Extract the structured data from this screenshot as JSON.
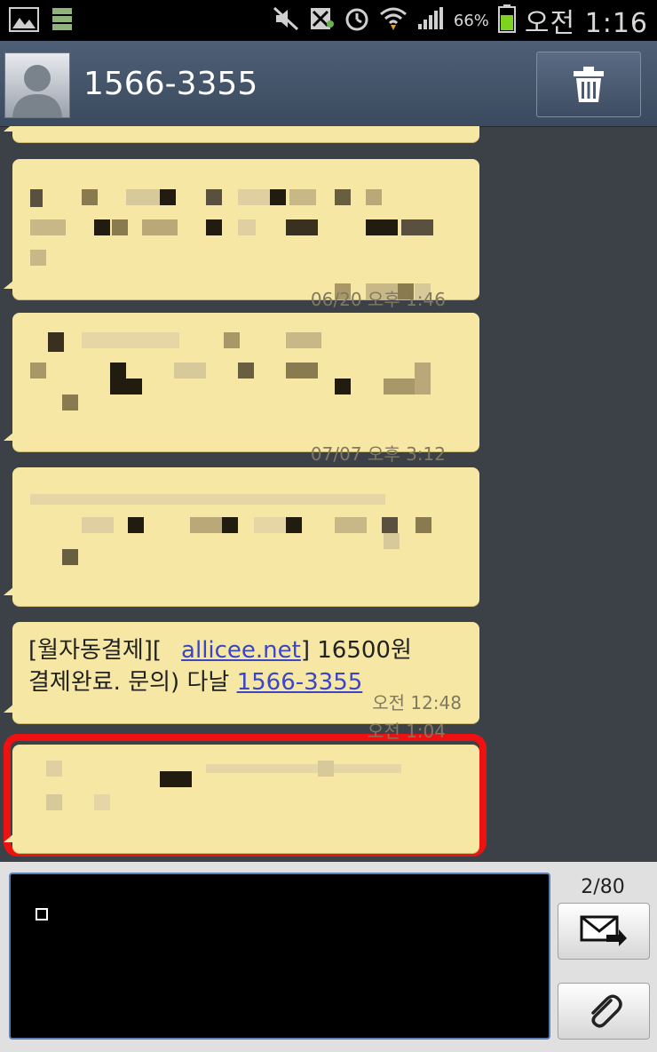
{
  "status_bar": {
    "battery_percent": "66%",
    "time": "오전 1:16",
    "icons": [
      "gallery-icon",
      "storage-icon",
      "mute-icon",
      "no-sim-icon",
      "alarm-icon",
      "wifi-icon",
      "signal-icon",
      "battery-icon"
    ]
  },
  "header": {
    "contact_name": "1566-3355",
    "delete_icon": "trash-icon"
  },
  "messages": [
    {
      "time": "",
      "redacted": true
    },
    {
      "time": "",
      "redacted": true
    },
    {
      "time": "06/20 오후 1:46",
      "redacted": true
    },
    {
      "time": "07/07 오후 3:12",
      "redacted": true
    },
    {
      "redacted": false,
      "highlighted": true,
      "line1_prefix": "[월자동결제][",
      "line1_link": "allicee.net",
      "line1_suffix": "]  16500원",
      "line2_prefix": "결제완료. 문의) 다날 ",
      "line2_link": "1566-3355",
      "time": "오전 12:48"
    },
    {
      "time": "오전 1:04",
      "redacted": true
    }
  ],
  "composer": {
    "char_counter": "2/80",
    "send_icon": "send-message-icon",
    "attach_icon": "paperclip-icon"
  },
  "colors": {
    "bubble": "#f6e8a4",
    "highlight": "#ee1111",
    "link": "#3a46c6",
    "header": "#4e5f76"
  }
}
